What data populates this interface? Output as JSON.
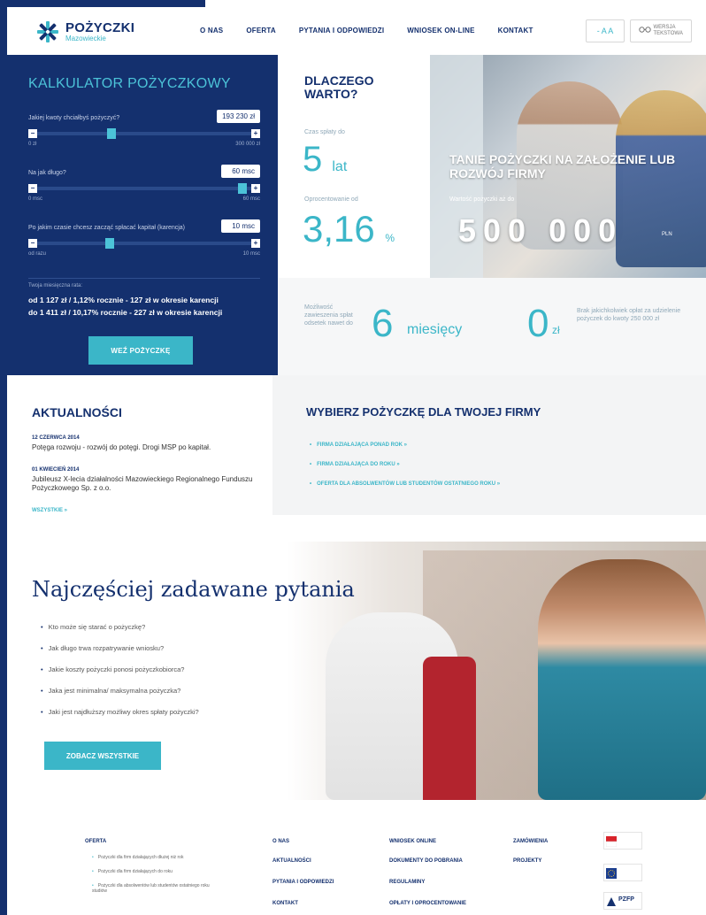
{
  "header": {
    "logo_title": "POŻYCZKI",
    "logo_sub": "Mazowieckie",
    "nav": [
      "O NAS",
      "OFERTA",
      "PYTANIA I ODPOWIEDZI",
      "WNIOSEK ON-LINE",
      "KONTAKT"
    ],
    "font_size_label": "- A A",
    "text_version_label": "WERSJA TEKSTOWA"
  },
  "calculator": {
    "title": "KALKULATOR POŻYCZKOWY",
    "q1": "Jakiej kwoty chciałbyś pożyczyć?",
    "v1": "193 230 zł",
    "min1": "0 zł",
    "max1": "300 000 zł",
    "fill1": 0.34,
    "q2": "Na jak długo?",
    "v2": "60 msc",
    "min2": "0 msc",
    "max2": "60 msc",
    "fill2": 0.98,
    "q3": "Po jakim czasie chcesz zacząć spłacać kapitał (karencja)",
    "v3": "10 msc",
    "min3": "od razu",
    "max3": "10 msc",
    "fill3": 0.33,
    "rate_label": "Twoja miesięczna rata:",
    "rate_line1": "od 1 127 zł / 1,12% rocznie - 127 zł w okresie karencji",
    "rate_line2": "do 1 411 zł / 10,17% rocznie - 227 zł w okresie karencji",
    "take_button": "WEŹ POŻYCZKĘ"
  },
  "why": {
    "title": "DLACZEGO WARTO?",
    "repay_label": "Czas spłaty do",
    "repay_value": "5",
    "repay_unit": "lat",
    "interest_label": "Oprocentowanie od",
    "interest_value": "3,16",
    "interest_unit": "%"
  },
  "hero": {
    "title": "TANIE POŻYCZKI NA ZAŁOŻENIE LUB ROZWÓJ FIRMY",
    "sub": "Wartość pożyczki aż do",
    "amount": "500 000",
    "currency": "PLN"
  },
  "months": {
    "label": "Możliwość zawieszenia spłat odsetek nawet do",
    "value": "6",
    "unit": "miesięcy",
    "zero_value": "0",
    "zero_unit": "zł",
    "zero_label": "Brak jakichkolwiek opłat za udzielenie pożyczek do kwoty 250 000 zł"
  },
  "news": {
    "title": "AKTUALNOŚCI",
    "items": [
      {
        "date": "12 CZERWCA 2014",
        "text": "Potęga rozwoju - rozwój do potęgi. Drogi MSP po kapitał."
      },
      {
        "date": "01 KWIECIEŃ 2014",
        "text": "Jubileusz X-lecia działalności Mazowieckiego Regionalnego Funduszu Pożyczkowego Sp. z o.o."
      }
    ],
    "all_link": "WSZYSTKIE »"
  },
  "choose": {
    "title": "WYBIERZ POŻYCZKĘ DLA TWOJEJ FIRMY",
    "items": [
      "FIRMA DZIAŁAJĄCA PONAD ROK »",
      "FIRMA DZIAŁAJĄCA DO ROKU »",
      "OFERTA DLA ABSOLWENTÓW LUB STUDENTÓW OSTATNIEGO ROKU »"
    ]
  },
  "faq": {
    "title": "Najczęściej zadawane pytania",
    "items": [
      "Kto może się starać o pożyczkę?",
      "Jak długo trwa rozpatrywanie wniosku?",
      "Jakie koszty pożyczki ponosi pożyczkobiorca?",
      "Jaka jest minimalna/ maksymalna pożyczka?",
      "Jaki jest najdłuższy możliwy okres spłaty pożyczki?"
    ],
    "button": "ZOBACZ WSZYSTKIE"
  },
  "footer": {
    "col1_title": "OFERTA",
    "col1_items": [
      "Pożyczki dla firm działających dłużej niż rok",
      "Pożyczki dla firm działających do roku",
      "Pożyczki dla absolwentów lub studentów ostatniego roku studiów"
    ],
    "col2_items": [
      "O NAS",
      "AKTUALNOŚCI",
      "PYTANIA I ODPOWIEDZI",
      "KONTAKT"
    ],
    "col3_items": [
      "WNIOSEK ONLINE",
      "DOKUMENTY DO POBRANIA",
      "REGULAMINY",
      "OPŁATY I OPROCENTOWANIE"
    ],
    "col4_items": [
      "ZAMÓWIENIA",
      "PROJEKTY"
    ],
    "partner_logo3": "PZFP"
  },
  "colors": {
    "navy": "#14306e",
    "teal": "#3bb6c8"
  }
}
